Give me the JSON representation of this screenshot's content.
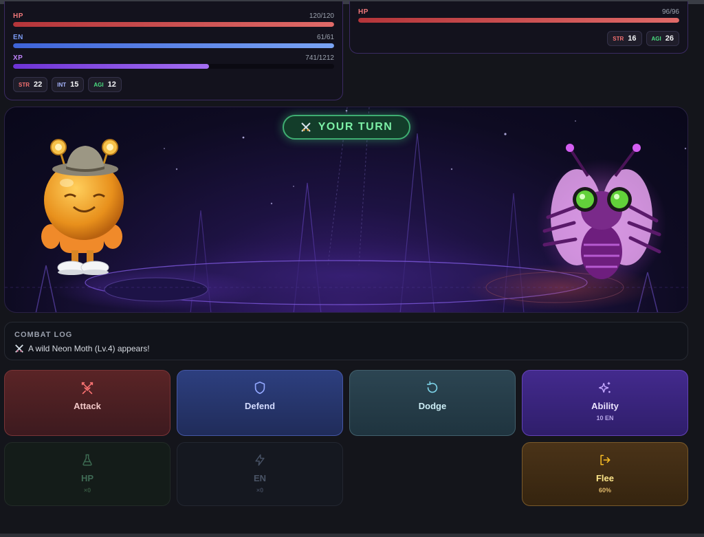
{
  "player": {
    "stats": [
      {
        "label": "HP",
        "value": "120/120",
        "fill": 1.0
      },
      {
        "label": "EN",
        "value": "61/61",
        "fill": 1.0
      },
      {
        "label": "XP",
        "value": "741/1212",
        "fill": 0.611
      }
    ],
    "attributes": [
      {
        "key": "STR",
        "value": "22"
      },
      {
        "key": "INT",
        "value": "15"
      },
      {
        "key": "AGI",
        "value": "12"
      }
    ]
  },
  "enemy": {
    "stats": [
      {
        "label": "HP",
        "value": "96/96",
        "fill": 1.0
      }
    ],
    "attributes": [
      {
        "key": "STR",
        "value": "16"
      },
      {
        "key": "AGI",
        "value": "26"
      }
    ]
  },
  "arena": {
    "turn_label": "YOUR TURN",
    "turn_icon": "crossed-swords-icon",
    "player_sprite": "orange-robot-with-hat",
    "enemy_sprite": "neon-moth"
  },
  "combat_log": {
    "title": "COMBAT LOG",
    "entries": [
      {
        "icon": "crossed-swords-icon",
        "text": "A wild Neon Moth (Lv.4) appears!"
      }
    ]
  },
  "actions": {
    "attack": {
      "label": "Attack",
      "icon": "sword-icon",
      "color": "#f87171"
    },
    "defend": {
      "label": "Defend",
      "icon": "shield-icon",
      "color": "#93a8ff"
    },
    "dodge": {
      "label": "Dodge",
      "icon": "rotate-icon",
      "color": "#7dd3e8"
    },
    "ability": {
      "label": "Ability",
      "sub": "10 EN",
      "icon": "sparkles-icon",
      "color": "#c4a7ff"
    },
    "hp_potion": {
      "label": "HP",
      "sub": "×0",
      "icon": "flask-icon",
      "color": "#3d6b52"
    },
    "en_potion": {
      "label": "EN",
      "sub": "×0",
      "icon": "lightning-icon",
      "color": "#465063"
    },
    "flee": {
      "label": "Flee",
      "sub": "60%",
      "icon": "exit-icon",
      "color": "#fbbf24"
    }
  }
}
